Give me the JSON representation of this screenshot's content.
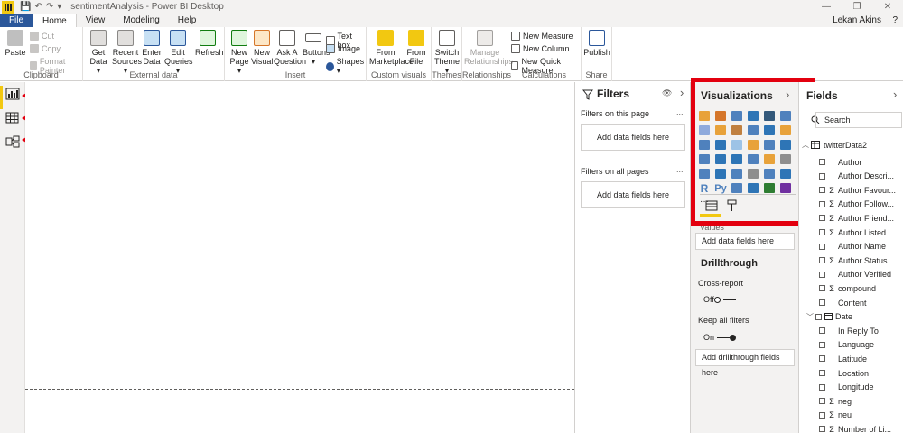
{
  "window": {
    "title": "sentimentAnalysis - Power BI Desktop",
    "quick_undo": "↶",
    "quick_redo": "↷",
    "quick_more": "▾",
    "save_glyph": "💾",
    "user": "Lekan Akins",
    "help_glyph": "?",
    "minimize_glyph": "—",
    "restore_glyph": "❐",
    "close_glyph": "✕"
  },
  "tabs": [
    "File",
    "Home",
    "View",
    "Modeling",
    "Help"
  ],
  "ribbon": {
    "clipboard": {
      "label": "Clipboard",
      "paste": "Paste",
      "cut": "Cut",
      "copy": "Copy",
      "format_painter": "Format Painter"
    },
    "external": {
      "label": "External data",
      "get_data": "Get Data ▾",
      "recent": "Recent Sources ▾",
      "enter": "Enter Data",
      "edit": "Edit Queries ▾",
      "refresh": "Refresh"
    },
    "insert": {
      "label": "Insert",
      "new_page": "New Page ▾",
      "new_visual": "New Visual",
      "ask": "Ask A Question",
      "buttons": "Buttons ▾",
      "textbox": "Text box",
      "image": "Image",
      "shapes": "Shapes ▾"
    },
    "custom": {
      "label": "Custom visuals",
      "marketplace": "From Marketplace",
      "file": "From File"
    },
    "themes": {
      "label": "Themes",
      "switch": "Switch Theme ▾"
    },
    "relationships": {
      "label": "Relationships",
      "manage": "Manage Relationships"
    },
    "calculations": {
      "label": "Calculations",
      "measure": "New Measure",
      "column": "New Column",
      "quick": "New Quick Measure"
    },
    "share": {
      "label": "Share",
      "publish": "Publish"
    }
  },
  "filters": {
    "title": "Filters",
    "on_page": "Filters on this page",
    "on_all": "Filters on all pages",
    "add": "Add data fields here",
    "more": "...",
    "eye_glyph": "👁",
    "collapse_glyph": "›"
  },
  "visualizations": {
    "title": "Visualizations",
    "collapse_glyph": "›",
    "more_glyph": "···",
    "r_label": "R",
    "py_label": "Py",
    "values_label": "Values",
    "add_values": "Add data fields here",
    "drillthrough": "Drillthrough",
    "cross_report": "Cross-report",
    "cross_state": "Off",
    "keep_filters": "Keep all filters",
    "keep_state": "On",
    "add_drill": "Add drillthrough fields here",
    "icon_colors": [
      "#e8a23a",
      "#d5762a",
      "#4f81bd",
      "#2e75b6",
      "#33587a",
      "#4f81bd",
      "#8faadc",
      "#e8a23a",
      "#c08040",
      "#4f81bd",
      "#2e75b6",
      "#e8a23a",
      "#4f81bd",
      "#2e75b6",
      "#9dc3e6",
      "#e8a23a",
      "#4f81bd",
      "#2e75b6",
      "#4f81bd",
      "#2e75b6",
      "#2e75b6",
      "#4f81bd",
      "#e8a23a",
      "#8e8e8e",
      "#4f81bd",
      "#2e75b6",
      "#4f81bd",
      "#8e8e8e",
      "#4f81bd",
      "#2e75b6",
      "#4f81bd",
      "#2e75b6",
      "#2e7d32",
      "#7030a0"
    ]
  },
  "fields": {
    "title": "Fields",
    "collapse_glyph": "›",
    "search_placeholder": "Search",
    "table": "twitterData2",
    "items": [
      {
        "name": "Author",
        "sigma": false
      },
      {
        "name": "Author Descri...",
        "sigma": false
      },
      {
        "name": "Author Favour...",
        "sigma": true
      },
      {
        "name": "Author Follow...",
        "sigma": true
      },
      {
        "name": "Author Friend...",
        "sigma": true
      },
      {
        "name": "Author Listed ...",
        "sigma": true
      },
      {
        "name": "Author Name",
        "sigma": false
      },
      {
        "name": "Author Status...",
        "sigma": true
      },
      {
        "name": "Author Verified",
        "sigma": false
      },
      {
        "name": "compound",
        "sigma": true
      },
      {
        "name": "Content",
        "sigma": false
      },
      {
        "name": "Date",
        "sigma": false,
        "table": true,
        "expand": true
      },
      {
        "name": "In Reply To",
        "sigma": false
      },
      {
        "name": "Language",
        "sigma": false
      },
      {
        "name": "Latitude",
        "sigma": false
      },
      {
        "name": "Location",
        "sigma": false
      },
      {
        "name": "Longitude",
        "sigma": false
      },
      {
        "name": "neg",
        "sigma": true
      },
      {
        "name": "neu",
        "sigma": true
      },
      {
        "name": "Number of Li...",
        "sigma": true
      }
    ]
  }
}
